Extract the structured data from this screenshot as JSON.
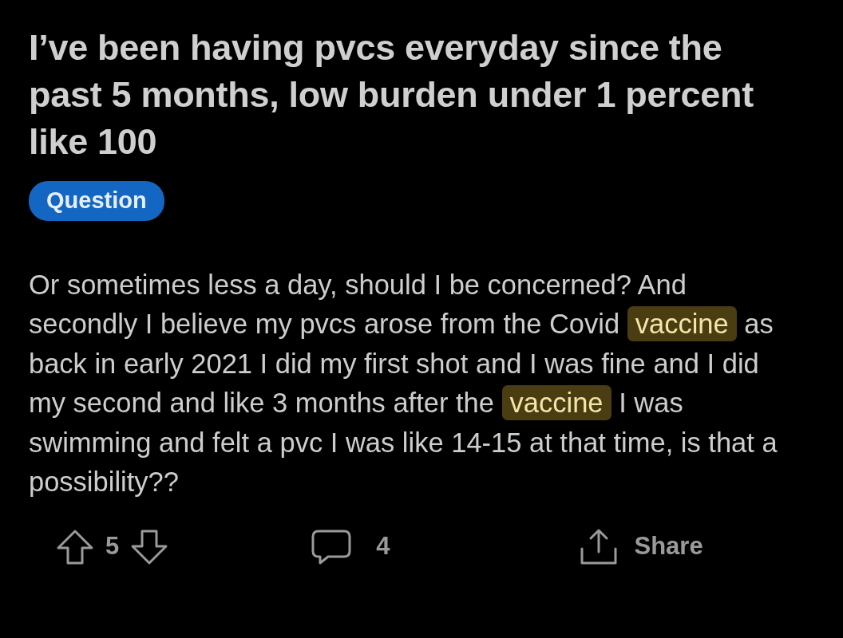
{
  "post": {
    "title": "I’ve been having pvcs everyday since the past 5 months, low burden under 1 percent like 100",
    "flair": "Question",
    "body": [
      {
        "text": "Or sometimes less a day, should I be concerned? And secondly I believe my pvcs arose from the Covid ",
        "highlighted": false
      },
      {
        "text": "vaccine",
        "highlighted": true
      },
      {
        "text": " as back in early 2021 I did my first shot and I was fine and I did my second and like 3 months after the ",
        "highlighted": false
      },
      {
        "text": "vaccine",
        "highlighted": true
      },
      {
        "text": " I was swimming and felt a pvc I was like 14-15 at that time, is that a possibility??",
        "highlighted": false
      }
    ]
  },
  "actions": {
    "votes": "5",
    "comments": "4",
    "share": "Share"
  }
}
